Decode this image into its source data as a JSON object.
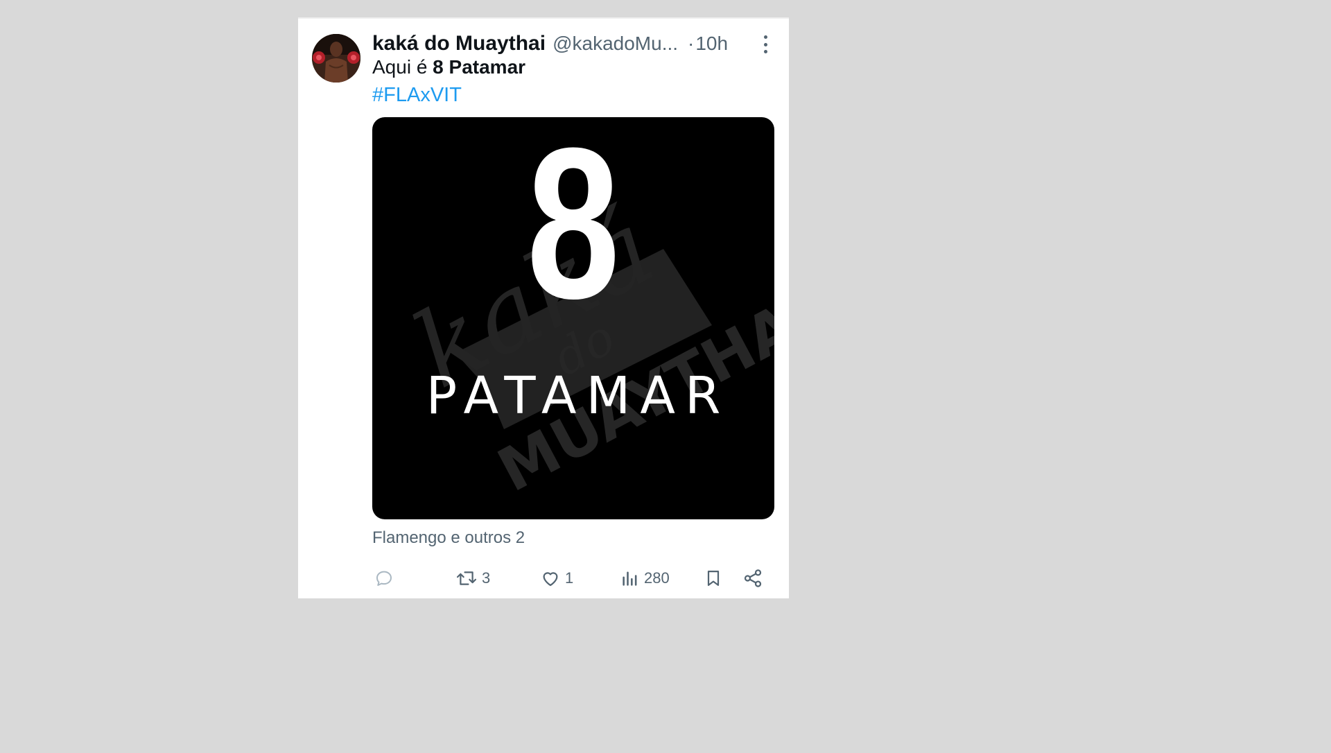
{
  "tweet": {
    "author_name": "kaká do Muaythai",
    "author_handle": "@kakadoMu...",
    "separator": "·",
    "time": "10h",
    "text_prefix": "Aqui é ",
    "text_bold": "8 Patamar",
    "hashtag": "#FLAxVIT",
    "media": {
      "big_text": "8",
      "word": "PATAMAR",
      "watermark_script": "kaká",
      "watermark_do": "do",
      "watermark_brand": "MUAYTHAI"
    },
    "tagged": "Flamengo e outros 2"
  },
  "actions": {
    "reply_count": "",
    "retweet_count": "3",
    "like_count": "1",
    "views_count": "280"
  },
  "icons": {
    "reply": "reply-icon",
    "retweet": "retweet-icon",
    "like": "heart-icon",
    "views": "views-chart-icon",
    "bookmark": "bookmark-icon",
    "share": "share-icon",
    "more": "more-vertical-icon"
  },
  "colors": {
    "link": "#1d9bf0",
    "muted": "#536471",
    "text": "#0f1419",
    "background": "#d9d9d9"
  }
}
